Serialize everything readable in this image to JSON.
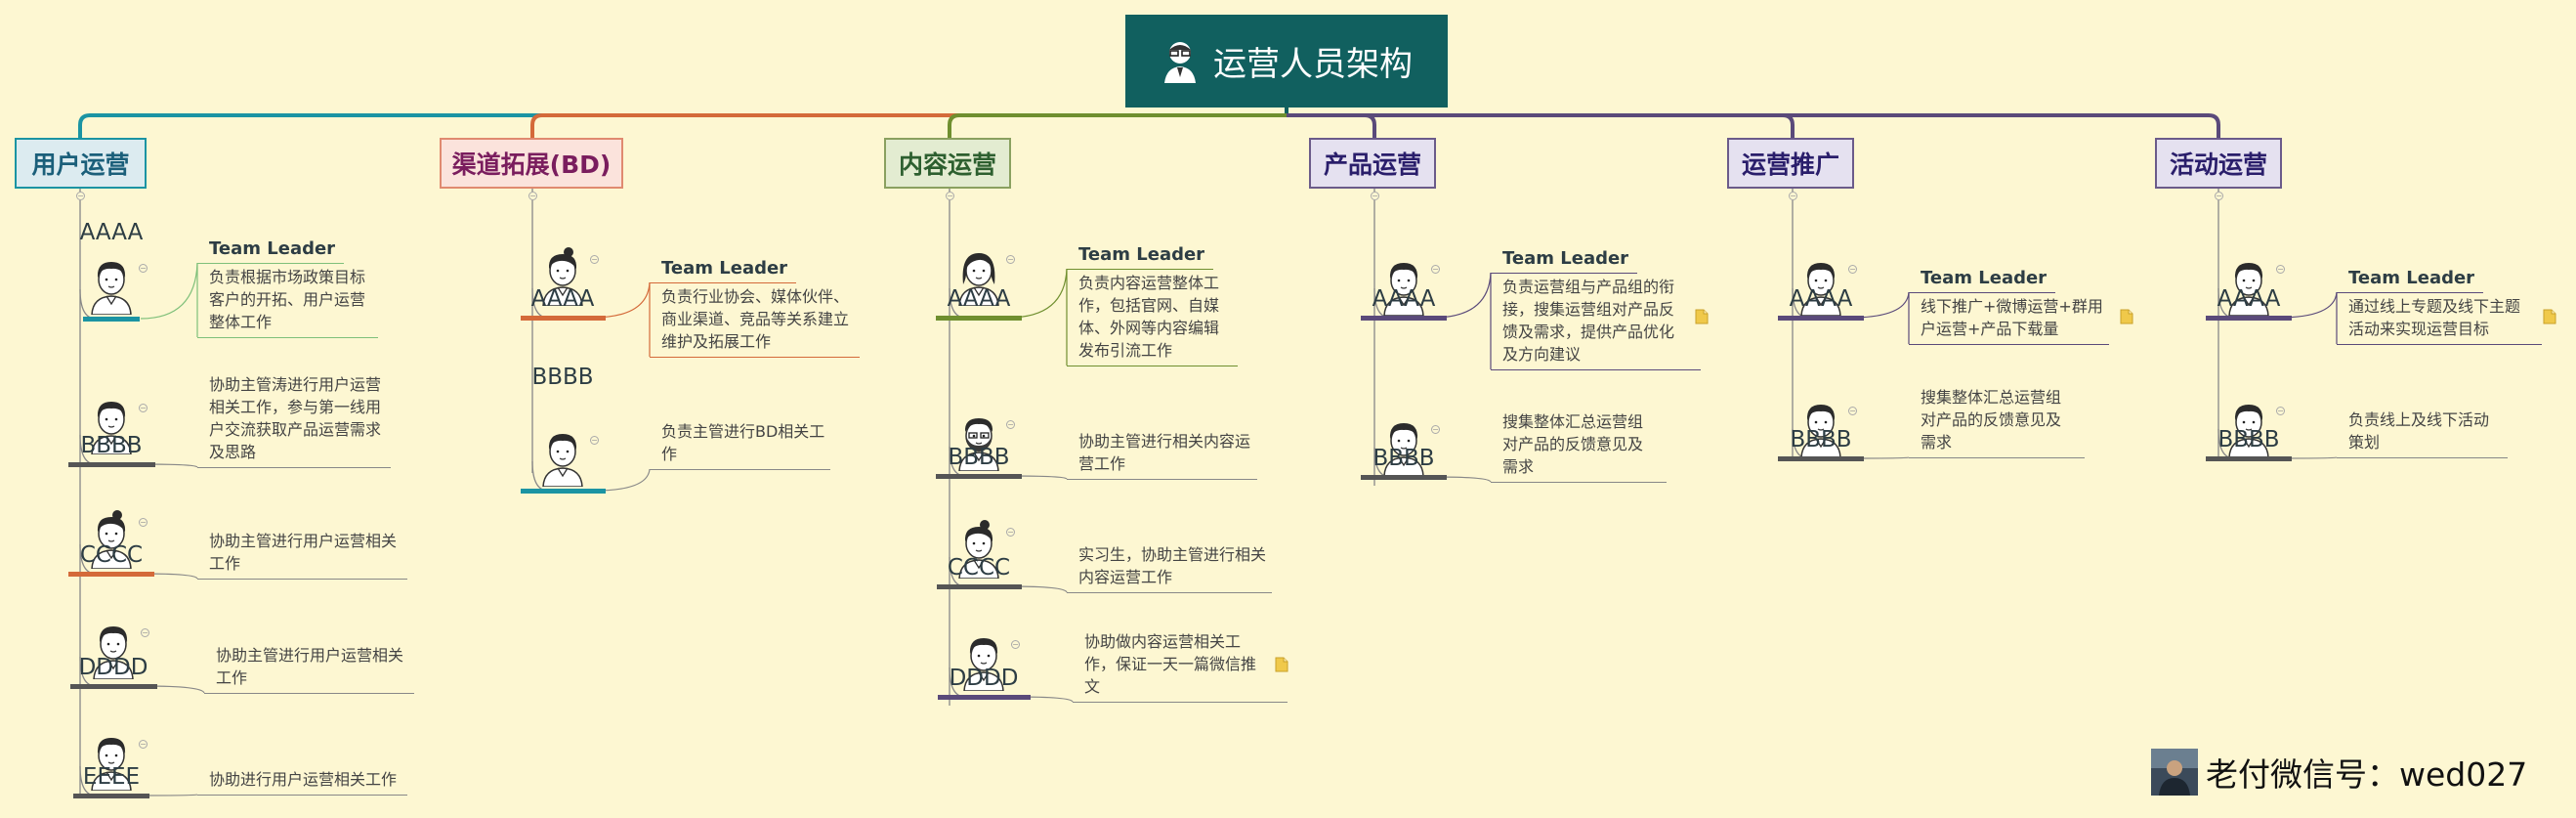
{
  "root": {
    "title": "运营人员架构",
    "icon": "person-with-glasses-icon"
  },
  "colors": {
    "root": "#11605f",
    "branch1": "#1b94a3",
    "branch2": "#d46a3a",
    "branch3": "#6f8f2f",
    "branch4": "#5a4a7a",
    "branch5": "#5a4a7a",
    "branch6": "#5a4a7a"
  },
  "branches": [
    {
      "title": "用户运营",
      "members": [
        {
          "name": "AAAA",
          "role": "Team Leader",
          "desc": [
            "负责根据市场政策目标",
            "客户的开拓、用户运营",
            "整体工作"
          ]
        },
        {
          "name": "BBBB",
          "desc": [
            "协助主管涛进行用户运营",
            "相关工作，参与第一线用",
            "户交流获取产品运营需求",
            "及思路"
          ]
        },
        {
          "name": "CCCC",
          "desc": [
            "协助主管进行用户运营相关",
            "工作"
          ]
        },
        {
          "name": "DDDD",
          "desc": [
            "协助主管进行用户运营相关",
            "工作"
          ]
        },
        {
          "name": "EEEE",
          "desc": [
            "协助进行用户运营相关工作"
          ]
        }
      ]
    },
    {
      "title": "渠道拓展(BD)",
      "members": [
        {
          "name": "AAAA",
          "role": "Team Leader",
          "desc": [
            "负责行业协会、媒体伙伴、",
            "商业渠道、竞品等关系建立",
            "维护及拓展工作"
          ]
        },
        {
          "name": "BBBB",
          "desc": [
            "负责主管进行BD相关工",
            "作"
          ]
        }
      ]
    },
    {
      "title": "内容运营",
      "members": [
        {
          "name": "AAAA",
          "role": "Team Leader",
          "desc": [
            "负责内容运营整体工",
            "作，包括官网、自媒",
            "体、外网等内容编辑",
            "发布引流工作"
          ]
        },
        {
          "name": "BBBB",
          "desc": [
            "协助主管进行相关内容运",
            "营工作"
          ]
        },
        {
          "name": "CCCC",
          "desc": [
            "实习生，协助主管进行相关",
            "内容运营工作"
          ]
        },
        {
          "name": "DDDD",
          "desc": [
            "协助做内容运营相关工",
            "作，保证一天一篇微信推",
            "文"
          ]
        }
      ]
    },
    {
      "title": "产品运营",
      "members": [
        {
          "name": "AAAA",
          "role": "Team Leader",
          "desc": [
            "负责运营组与产品组的衔",
            "接，搜集运营组对产品反",
            "馈及需求，提供产品优化",
            "及方向建议"
          ]
        },
        {
          "name": "BBBB",
          "desc": [
            "搜集整体汇总运营组",
            "对产品的反馈意见及",
            "需求"
          ]
        }
      ]
    },
    {
      "title": "运营推广",
      "members": [
        {
          "name": "AAAA",
          "role": "Team Leader",
          "desc": [
            "线下推广+微博运营+群用",
            "户运营+产品下载量"
          ]
        },
        {
          "name": "BBBB",
          "desc": [
            "搜集整体汇总运营组",
            "对产品的反馈意见及",
            "需求"
          ]
        }
      ]
    },
    {
      "title": "活动运营",
      "members": [
        {
          "name": "AAAA",
          "role": "Team Leader",
          "desc": [
            "通过线上专题及线下主题",
            "活动来实现运营目标"
          ]
        },
        {
          "name": "BBBB",
          "desc": [
            "负责线上及线下活动",
            "策划"
          ]
        }
      ]
    }
  ],
  "watermark": {
    "text": "老付微信号：wed027",
    "icon": "profile-photo-icon"
  }
}
